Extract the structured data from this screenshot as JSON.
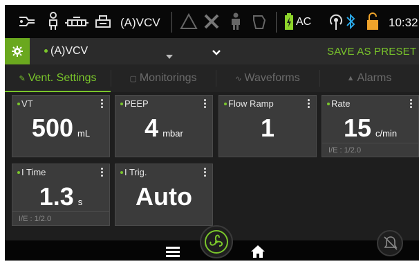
{
  "status_bar": {
    "mode": "(A)VCV",
    "power": "AC",
    "clock": "10:32",
    "icons": [
      "connection-icon",
      "patient-icon",
      "circuit-icon",
      "humidifier-icon",
      "alarm-triangle-icon",
      "tools-icon",
      "person-icon",
      "mask-icon",
      "battery-icon",
      "network-icon",
      "bluetooth-icon",
      "lock-icon"
    ]
  },
  "preset_bar": {
    "mode": "(A)VCV",
    "save_label": "SAVE AS PRESET"
  },
  "tabs": [
    {
      "label": "Vent. Settings",
      "glyph": "🔧",
      "active": true
    },
    {
      "label": "Monitorings",
      "glyph": "▢",
      "active": false
    },
    {
      "label": "Waveforms",
      "glyph": "∿",
      "active": false
    },
    {
      "label": "Alarms",
      "glyph": "🔔",
      "active": false
    }
  ],
  "parameters": [
    {
      "label": "VT",
      "value": "500",
      "unit": "mL",
      "sub": ""
    },
    {
      "label": "PEEP",
      "value": "4",
      "unit": "mbar",
      "sub": ""
    },
    {
      "label": "Flow Ramp",
      "value": "1",
      "unit": "",
      "sub": ""
    },
    {
      "label": "Rate",
      "value": "15",
      "unit": "c/min",
      "sub": "I/E : 1/2.0"
    },
    {
      "label": "I Time",
      "value": "1.3",
      "unit": "s",
      "sub": "I/E : 1/2.0"
    },
    {
      "label": "I Trig.",
      "value": "Auto",
      "unit": "",
      "sub": ""
    }
  ],
  "colors": {
    "accent": "#7ac62b",
    "battery": "#8dd42b",
    "bluetooth": "#2aa8e6",
    "lock": "#f0a42b"
  }
}
